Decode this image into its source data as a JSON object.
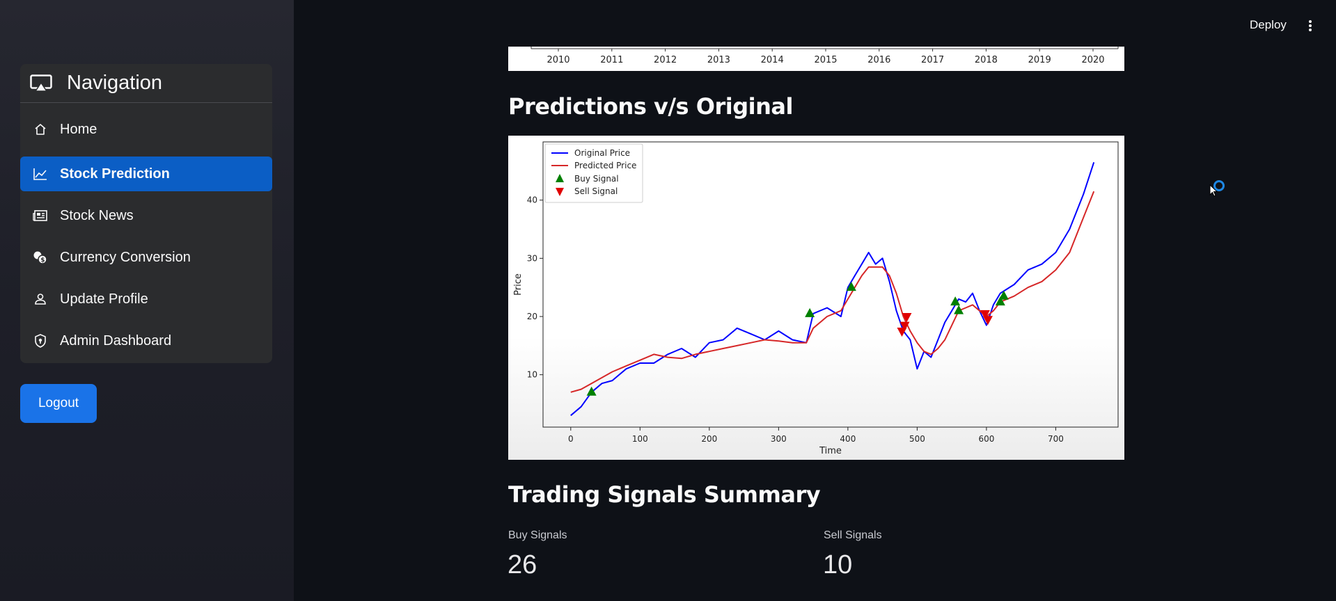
{
  "sidebar": {
    "title": "Navigation",
    "items": [
      {
        "label": "Home",
        "icon": "home-icon"
      },
      {
        "label": "Stock Prediction",
        "icon": "line-chart-icon",
        "active": true
      },
      {
        "label": "Stock News",
        "icon": "newspaper-icon"
      },
      {
        "label": "Currency Conversion",
        "icon": "coins-icon"
      },
      {
        "label": "Update Profile",
        "icon": "person-icon"
      },
      {
        "label": "Admin Dashboard",
        "icon": "shield-icon"
      }
    ],
    "logout_label": "Logout"
  },
  "header": {
    "deploy_label": "Deploy"
  },
  "colors": {
    "accent": "#0b5ec5",
    "button": "#1a73e8",
    "original_line": "#0000ff",
    "predicted_line": "#d62728",
    "buy": "#008000",
    "sell": "#e00000"
  },
  "main": {
    "prev_chart_years": [
      "2010",
      "2011",
      "2012",
      "2013",
      "2014",
      "2015",
      "2016",
      "2017",
      "2018",
      "2019",
      "2020"
    ],
    "predictions_title": "Predictions v/s Original",
    "summary_title": "Trading Signals Summary",
    "buy_label": "Buy Signals",
    "buy_value": "26",
    "sell_label": "Sell Signals",
    "sell_value": "10"
  },
  "chart_data": {
    "type": "line",
    "xlabel": "Time",
    "ylabel": "Price",
    "xlim": [
      -40,
      790
    ],
    "ylim": [
      1,
      50
    ],
    "xticks": [
      0,
      100,
      200,
      300,
      400,
      500,
      600,
      700
    ],
    "yticks": [
      10,
      20,
      30,
      40
    ],
    "legend": [
      "Original Price",
      "Predicted Price",
      "Buy Signal",
      "Sell Signal"
    ],
    "legend_position": "top-left",
    "series": [
      {
        "name": "Original Price",
        "x": [
          0,
          15,
          30,
          45,
          60,
          80,
          100,
          120,
          140,
          160,
          180,
          200,
          220,
          240,
          260,
          280,
          300,
          320,
          340,
          350,
          370,
          390,
          400,
          410,
          420,
          430,
          440,
          450,
          460,
          470,
          480,
          490,
          500,
          510,
          520,
          530,
          540,
          550,
          560,
          570,
          580,
          590,
          600,
          610,
          620,
          640,
          660,
          680,
          700,
          720,
          740,
          755
        ],
        "y": [
          3,
          4.5,
          7,
          8.5,
          9,
          11,
          12,
          12,
          13.5,
          14.5,
          13,
          15.5,
          16,
          18,
          17,
          16,
          17.5,
          16,
          15.5,
          20.5,
          21.5,
          20,
          25,
          27,
          29,
          31,
          29,
          30,
          26,
          21,
          17.5,
          16,
          11,
          14,
          13,
          16,
          19,
          21,
          23,
          22.5,
          24,
          21,
          18.5,
          22,
          24,
          25.5,
          28,
          29,
          31,
          35,
          41,
          46.5
        ]
      },
      {
        "name": "Predicted Price",
        "x": [
          0,
          15,
          30,
          45,
          60,
          80,
          100,
          120,
          140,
          160,
          180,
          200,
          220,
          240,
          260,
          280,
          300,
          320,
          340,
          350,
          370,
          390,
          400,
          410,
          420,
          430,
          440,
          450,
          460,
          470,
          480,
          490,
          500,
          510,
          520,
          530,
          540,
          550,
          560,
          570,
          580,
          590,
          600,
          610,
          620,
          640,
          660,
          680,
          700,
          720,
          740,
          755
        ],
        "y": [
          7,
          7.5,
          8.5,
          9.5,
          10.5,
          11.5,
          12.5,
          13.5,
          13,
          12.8,
          13.5,
          14,
          14.5,
          15,
          15.5,
          16,
          15.8,
          15.5,
          15.5,
          18,
          20,
          21,
          23,
          25,
          27,
          28.5,
          28.5,
          28.5,
          27,
          24,
          20,
          17.5,
          15.5,
          14,
          13.5,
          14.5,
          16,
          18.5,
          21,
          21.5,
          22,
          21,
          20,
          21,
          22.5,
          23.5,
          25,
          26,
          28,
          31,
          37,
          41.5
        ]
      }
    ],
    "buy_signals": {
      "x": [
        30,
        345,
        405,
        555,
        560,
        620,
        625
      ],
      "y": [
        7,
        20.5,
        25,
        22.5,
        21,
        22.5,
        23.5
      ]
    },
    "sell_signals": {
      "x": [
        478,
        482,
        485,
        598,
        602
      ],
      "y": [
        17.5,
        18.5,
        20,
        20.5,
        19.5
      ]
    }
  }
}
